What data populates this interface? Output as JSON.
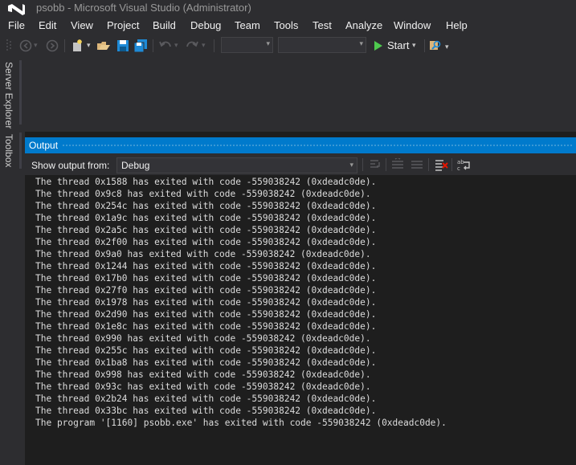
{
  "window": {
    "title": "psobb - Microsoft Visual Studio (Administrator)"
  },
  "menu": [
    "File",
    "Edit",
    "View",
    "Project",
    "Build",
    "Debug",
    "Team",
    "Tools",
    "Test",
    "Analyze",
    "Window",
    "Help"
  ],
  "toolbar": {
    "start_label": "Start"
  },
  "side_tabs": {
    "server_explorer": "Server Explorer",
    "toolbox": "Toolbox"
  },
  "output": {
    "title": "Output",
    "show_output_from_label": "Show output from:",
    "source": "Debug",
    "lines": [
      "The thread 0x1588 has exited with code -559038242 (0xdeadc0de).",
      "The thread 0x9c8 has exited with code -559038242 (0xdeadc0de).",
      "The thread 0x254c has exited with code -559038242 (0xdeadc0de).",
      "The thread 0x1a9c has exited with code -559038242 (0xdeadc0de).",
      "The thread 0x2a5c has exited with code -559038242 (0xdeadc0de).",
      "The thread 0x2f00 has exited with code -559038242 (0xdeadc0de).",
      "The thread 0x9a0 has exited with code -559038242 (0xdeadc0de).",
      "The thread 0x1244 has exited with code -559038242 (0xdeadc0de).",
      "The thread 0x17b0 has exited with code -559038242 (0xdeadc0de).",
      "The thread 0x27f0 has exited with code -559038242 (0xdeadc0de).",
      "The thread 0x1978 has exited with code -559038242 (0xdeadc0de).",
      "The thread 0x2d90 has exited with code -559038242 (0xdeadc0de).",
      "The thread 0x1e8c has exited with code -559038242 (0xdeadc0de).",
      "The thread 0x990 has exited with code -559038242 (0xdeadc0de).",
      "The thread 0x255c has exited with code -559038242 (0xdeadc0de).",
      "The thread 0x1ba8 has exited with code -559038242 (0xdeadc0de).",
      "The thread 0x998 has exited with code -559038242 (0xdeadc0de).",
      "The thread 0x93c has exited with code -559038242 (0xdeadc0de).",
      "The thread 0x2b24 has exited with code -559038242 (0xdeadc0de).",
      "The thread 0x33bc has exited with code -559038242 (0xdeadc0de).",
      "The program '[1160] psobb.exe' has exited with code -559038242 (0xdeadc0de)."
    ]
  },
  "colors": {
    "accent": "#007acc",
    "background": "#2d2d30",
    "output_background": "#1e1e1e",
    "text": "#f1f1f1",
    "logo": "#68217a"
  }
}
